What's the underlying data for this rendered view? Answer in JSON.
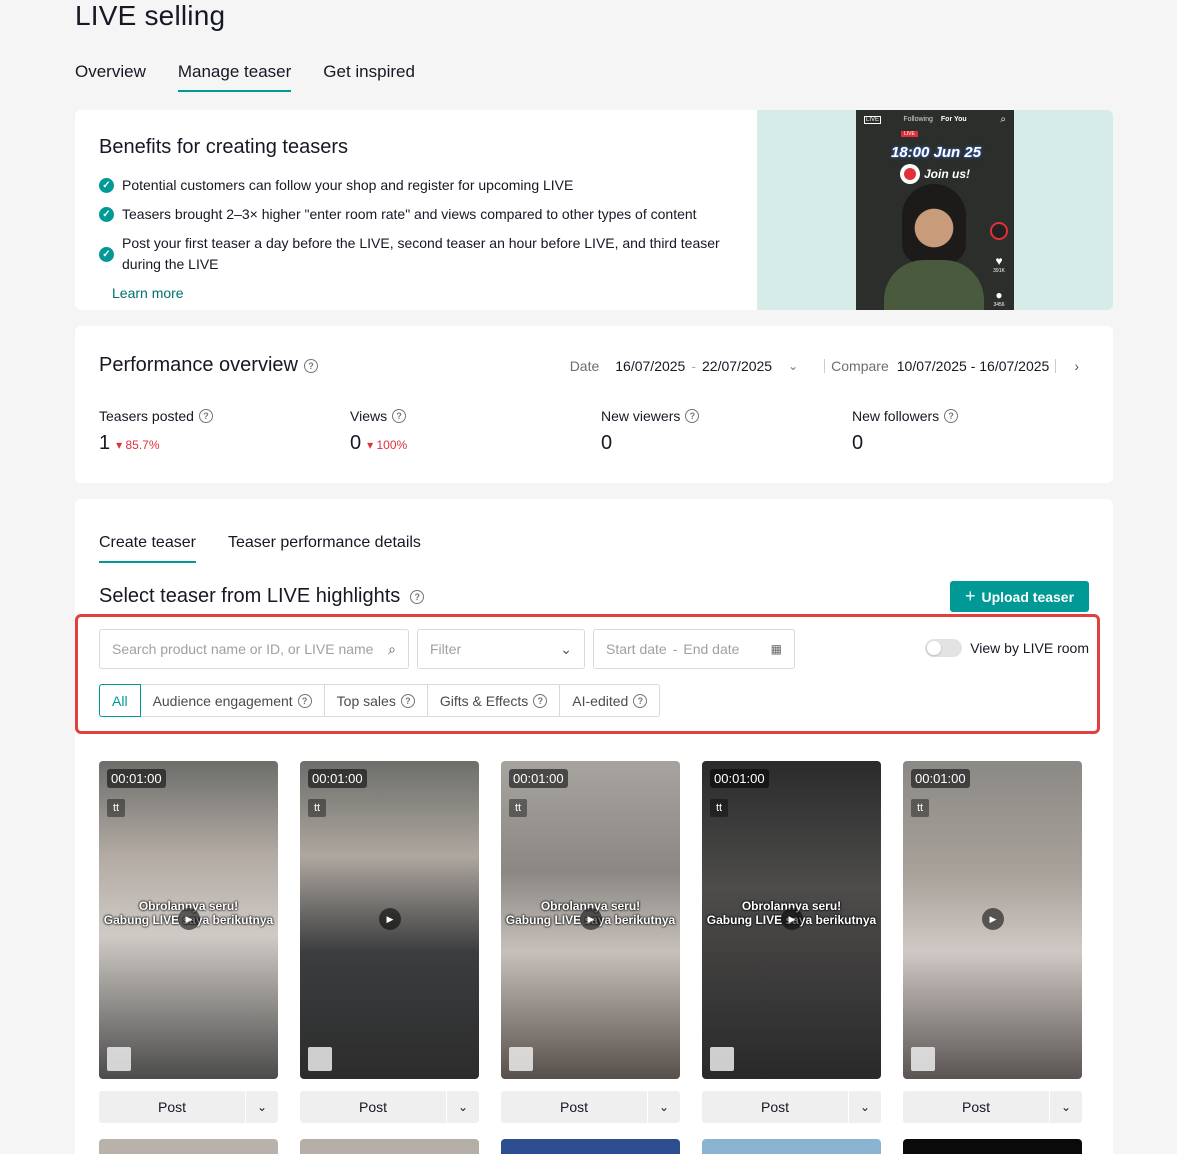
{
  "page": {
    "title": "LIVE selling"
  },
  "top_tabs": [
    {
      "label": "Overview",
      "active": false
    },
    {
      "label": "Manage teaser",
      "active": true
    },
    {
      "label": "Get inspired",
      "active": false
    }
  ],
  "benefits": {
    "title": "Benefits for creating teasers",
    "items": [
      "Potential customers can follow your shop and register for upcoming LIVE",
      "Teasers brought 2–3× higher \"enter room rate\" and views compared to other types of content",
      "Post your first teaser a day before the LIVE, second teaser an hour before LIVE, and third teaser during the LIVE"
    ],
    "learn_more": "Learn more",
    "preview": {
      "live_label": "LIVE",
      "feed_following": "Following",
      "feed_for_you": "For You",
      "badge": "LIVE",
      "time_text": "18:00 Jun 25",
      "join_text": "Join us!",
      "likes": "391K",
      "comments": "3456"
    }
  },
  "performance": {
    "title": "Performance overview",
    "date_label": "Date",
    "date_start": "16/07/2025",
    "date_end": "22/07/2025",
    "compare_label": "Compare",
    "compare_range": "10/07/2025 - 16/07/2025",
    "metrics": [
      {
        "label": "Teasers posted",
        "value": "1",
        "delta": "85.7%",
        "delta_dir": "down"
      },
      {
        "label": "Views",
        "value": "0",
        "delta": "100%",
        "delta_dir": "down"
      },
      {
        "label": "New viewers",
        "value": "0",
        "delta": ""
      },
      {
        "label": "New followers",
        "value": "0",
        "delta": ""
      }
    ]
  },
  "teaser": {
    "tabs": [
      {
        "label": "Create teaser",
        "active": true
      },
      {
        "label": "Teaser performance details",
        "active": false
      }
    ],
    "section_title": "Select teaser from LIVE highlights",
    "upload_label": "Upload teaser",
    "search_placeholder": "Search product name or ID, or LIVE name",
    "filter_placeholder": "Filter",
    "start_date": "Start date",
    "end_date": "End date",
    "view_by_room": "View by LIVE room",
    "segments": [
      "All",
      "Audience engagement",
      "Top sales",
      "Gifts & Effects",
      "AI-edited"
    ],
    "videos": [
      {
        "duration": "00:01:00",
        "caption_1": "Obrolannya seru!",
        "caption_2": "Gabung LIVE saya berikutnya",
        "post_label": "Post"
      },
      {
        "duration": "00:01:00",
        "caption_1": "",
        "caption_2": "",
        "post_label": "Post"
      },
      {
        "duration": "00:01:00",
        "caption_1": "Obrolannya seru!",
        "caption_2": "Gabung LIVE saya berikutnya",
        "post_label": "Post"
      },
      {
        "duration": "00:01:00",
        "caption_1": "Obrolannya seru!",
        "caption_2": "Gabung LIVE saya berikutnya",
        "post_label": "Post"
      },
      {
        "duration": "00:01:00",
        "caption_1": "",
        "caption_2": "",
        "post_label": "Post"
      }
    ]
  },
  "colors": {
    "accent": "#009995",
    "danger": "#e0303a",
    "highlight_border": "#e0403f"
  }
}
